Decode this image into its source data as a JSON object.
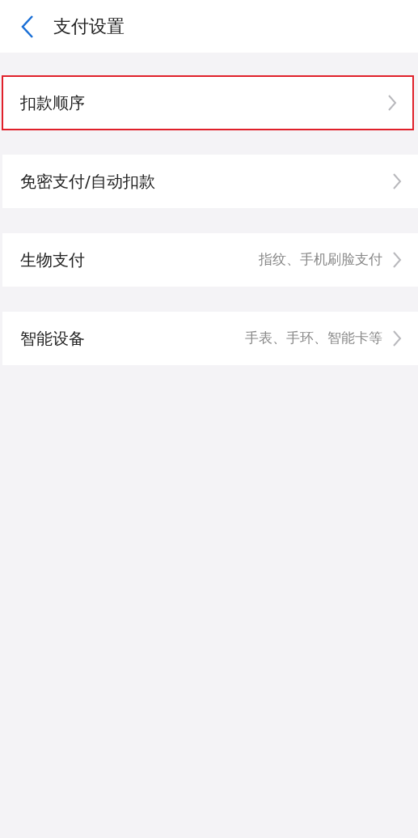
{
  "header": {
    "title": "支付设置"
  },
  "sections": [
    {
      "label": "扣款顺序",
      "highlighted": true
    },
    {
      "label": "免密支付/自动扣款",
      "highlighted": false
    },
    {
      "label": "生物支付",
      "detail": "指纹、手机刷脸支付",
      "highlighted": false
    },
    {
      "label": "智能设备",
      "detail": "手表、手环、智能卡等",
      "highlighted": false
    }
  ]
}
